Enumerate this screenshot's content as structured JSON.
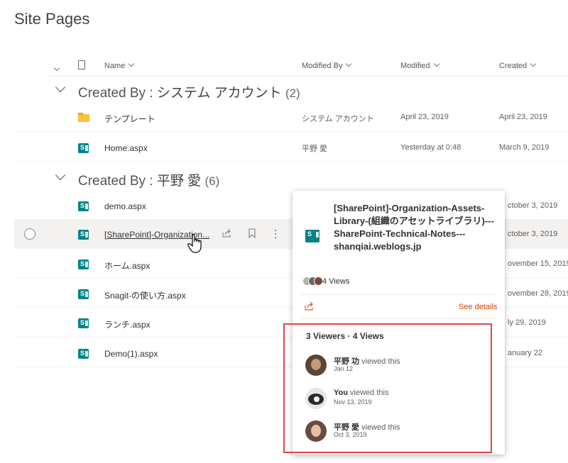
{
  "page_title": "Site Pages",
  "columns": {
    "name": "Name",
    "modified_by": "Modified By",
    "modified": "Modified",
    "created": "Created"
  },
  "groups": [
    {
      "label": "Created By : ",
      "value": "システム アカウント",
      "count": "(2)",
      "rows": [
        {
          "name": "テンプレート",
          "modified_by": "システム アカウント",
          "modified": "April 23, 2019",
          "created": "April 23, 2019",
          "icon": "folder-icon"
        },
        {
          "name": "Home.aspx",
          "modified_by": "平野 愛",
          "modified": "Yesterday at 0:48",
          "created": "March 9, 2019",
          "icon": "sharepoint-page-icon"
        }
      ]
    },
    {
      "label": "Created By : ",
      "value": "平野 愛",
      "count": "(6)",
      "rows": [
        {
          "name": "demo.aspx",
          "created": "ctober 3, 2019",
          "icon": "sharepoint-page-icon"
        },
        {
          "name": "[SharePoint]-Organization...",
          "created": "ctober 3, 2019",
          "icon": "sharepoint-page-icon"
        },
        {
          "name": "ホーム.aspx",
          "created": "ovember 15, 2019",
          "icon": "sharepoint-page-icon"
        },
        {
          "name": "Snagit-の使い方.aspx",
          "created": "ovember 28, 2019",
          "icon": "sharepoint-page-icon"
        },
        {
          "name": "ランチ.aspx",
          "created": "ly 29, 2019",
          "icon": "sharepoint-page-icon"
        },
        {
          "name": "Demo(1).aspx",
          "created": "anuary 22",
          "icon": "sharepoint-page-icon"
        }
      ]
    }
  ],
  "hover_card": {
    "title": "[SharePoint]-Organization-Assets-Library-(組織のアセットライブラリ)---SharePoint-Technical-Notes---shanqiai.weblogs.jp",
    "views": "4 Views",
    "see_details": "See details",
    "viewers_summary": "3 Viewers · 4 Views",
    "viewers": [
      {
        "name": "平野 功",
        "action": " viewed this",
        "date": "Jan 12"
      },
      {
        "name": "You",
        "action": " viewed this",
        "date": "Nov 13, 2019"
      },
      {
        "name": "平野 愛",
        "action": " viewed this",
        "date": "Oct 3, 2019"
      }
    ]
  },
  "colors": {
    "sharepoint_icon": "#038387",
    "folder": "#f8c23a",
    "highlight_border": "#e0454b",
    "share_icon": "#d83b01"
  }
}
